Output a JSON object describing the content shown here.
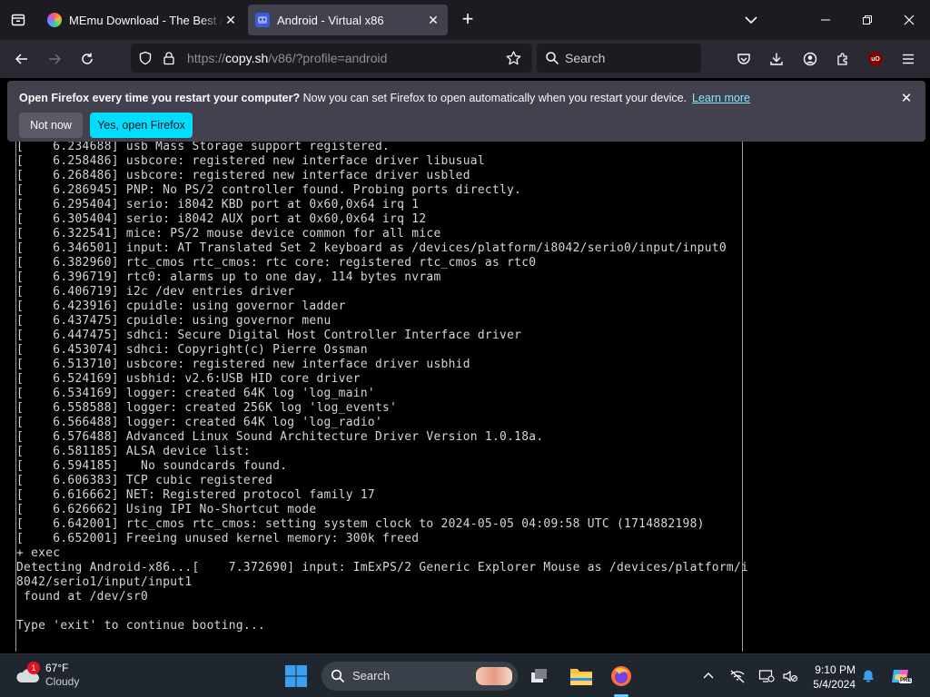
{
  "browser": {
    "tabs": [
      {
        "title": "MEmu Download - The Best Android Emulator",
        "active": false
      },
      {
        "title": "Android - Virtual x86",
        "active": true
      }
    ],
    "url": {
      "prefix": "https://",
      "host": "copy.sh",
      "path": "/v86/?profile=android"
    },
    "search_placeholder": "Search",
    "ublock_badge": "uO"
  },
  "notification": {
    "bold": "Open Firefox every time you restart your computer?",
    "text": " Now you can set Firefox to open automatically when you restart your device.",
    "link": "Learn more",
    "not_now": "Not now",
    "open": "Yes, open Firefox"
  },
  "terminal": {
    "lines": [
      "[    6.234688] usb Mass Storage support registered.",
      "[    6.258486] usbcore: registered new interface driver libusual",
      "[    6.268486] usbcore: registered new interface driver usbled",
      "[    6.286945] PNP: No PS/2 controller found. Probing ports directly.",
      "[    6.295404] serio: i8042 KBD port at 0x60,0x64 irq 1",
      "[    6.305404] serio: i8042 AUX port at 0x60,0x64 irq 12",
      "[    6.322541] mice: PS/2 mouse device common for all mice",
      "[    6.346501] input: AT Translated Set 2 keyboard as /devices/platform/i8042/serio0/input/input0",
      "[    6.382960] rtc_cmos rtc_cmos: rtc core: registered rtc_cmos as rtc0",
      "[    6.396719] rtc0: alarms up to one day, 114 bytes nvram",
      "[    6.406719] i2c /dev entries driver",
      "[    6.423916] cpuidle: using governor ladder",
      "[    6.437475] cpuidle: using governor menu",
      "[    6.447475] sdhci: Secure Digital Host Controller Interface driver",
      "[    6.453074] sdhci: Copyright(c) Pierre Ossman",
      "[    6.513710] usbcore: registered new interface driver usbhid",
      "[    6.524169] usbhid: v2.6:USB HID core driver",
      "[    6.534169] logger: created 64K log 'log_main'",
      "[    6.558588] logger: created 256K log 'log_events'",
      "[    6.566488] logger: created 64K log 'log_radio'",
      "[    6.576488] Advanced Linux Sound Architecture Driver Version 1.0.18a.",
      "[    6.581185] ALSA device list:",
      "[    6.594185]   No soundcards found.",
      "[    6.606383] TCP cubic registered",
      "[    6.616662] NET: Registered protocol family 17",
      "[    6.626662] Using IPI No-Shortcut mode",
      "[    6.642001] rtc_cmos rtc_cmos: setting system clock to 2024-05-05 04:09:58 UTC (1714882198)",
      "[    6.652001] Freeing unused kernel memory: 300k freed",
      "+ exec",
      "Detecting Android-x86...[    7.372690] input: ImExPS/2 Generic Explorer Mouse as /devices/platform/i",
      "8042/serio1/input/input1",
      " found at /dev/sr0",
      "",
      "Type 'exit' to continue booting..."
    ]
  },
  "taskbar": {
    "weather_temp": "67°F",
    "weather_desc": "Cloudy",
    "weather_badge": "1",
    "search_placeholder": "Search",
    "time": "9:10 PM",
    "date": "5/4/2024",
    "copilot_badge": "PRE"
  },
  "colors": {
    "accent": "#00ddff",
    "link": "#80ebff",
    "tab_bg": "#1c1b22",
    "toolbar_bg": "#2b2a33"
  }
}
